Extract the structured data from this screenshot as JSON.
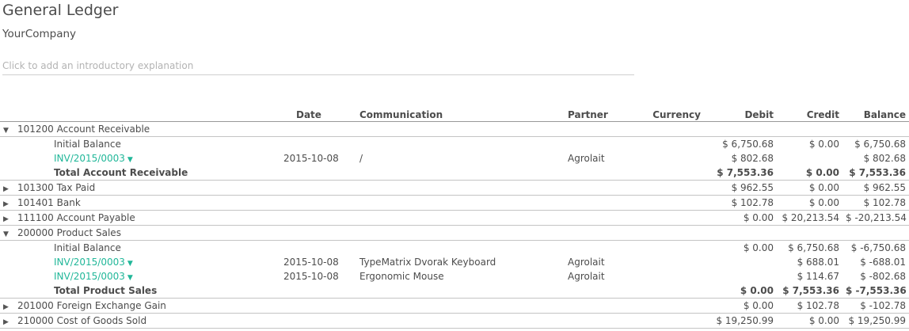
{
  "report": {
    "title": "General Ledger",
    "company": "YourCompany",
    "intro_placeholder": "Click to add an introductory explanation"
  },
  "columns": {
    "date": "Date",
    "communication": "Communication",
    "partner": "Partner",
    "currency": "Currency",
    "debit": "Debit",
    "credit": "Credit",
    "balance": "Balance"
  },
  "rows": [
    {
      "type": "account",
      "expanded": true,
      "name": "101200 Account Receivable",
      "debit": "",
      "credit": "",
      "balance": ""
    },
    {
      "type": "initial",
      "name": "Initial Balance",
      "date": "",
      "communication": "",
      "partner": "",
      "debit": "$ 6,750.68",
      "credit": "$ 0.00",
      "balance": "$ 6,750.68"
    },
    {
      "type": "move",
      "name": "INV/2015/0003",
      "date": "2015-10-08",
      "communication": "/",
      "partner": "Agrolait",
      "debit": "$ 802.68",
      "credit": "",
      "balance": "$ 802.68"
    },
    {
      "type": "total",
      "name": "Total Account Receivable",
      "debit": "$ 7,553.36",
      "credit": "$ 0.00",
      "balance": "$ 7,553.36"
    },
    {
      "type": "account",
      "expanded": false,
      "name": "101300 Tax Paid",
      "debit": "$ 962.55",
      "credit": "$ 0.00",
      "balance": "$ 962.55"
    },
    {
      "type": "account",
      "expanded": false,
      "name": "101401 Bank",
      "debit": "$ 102.78",
      "credit": "$ 0.00",
      "balance": "$ 102.78"
    },
    {
      "type": "account",
      "expanded": false,
      "name": "111100 Account Payable",
      "debit": "$ 0.00",
      "credit": "$ 20,213.54",
      "balance": "$ -20,213.54"
    },
    {
      "type": "account",
      "expanded": true,
      "name": "200000 Product Sales",
      "debit": "",
      "credit": "",
      "balance": ""
    },
    {
      "type": "initial",
      "name": "Initial Balance",
      "date": "",
      "communication": "",
      "partner": "",
      "debit": "$ 0.00",
      "credit": "$ 6,750.68",
      "balance": "$ -6,750.68"
    },
    {
      "type": "move",
      "name": "INV/2015/0003",
      "date": "2015-10-08",
      "communication": "TypeMatrix Dvorak Keyboard",
      "partner": "Agrolait",
      "debit": "",
      "credit": "$ 688.01",
      "balance": "$ -688.01"
    },
    {
      "type": "move",
      "name": "INV/2015/0003",
      "date": "2015-10-08",
      "communication": "Ergonomic Mouse",
      "partner": "Agrolait",
      "debit": "",
      "credit": "$ 114.67",
      "balance": "$ -802.68"
    },
    {
      "type": "total",
      "name": "Total Product Sales",
      "debit": "$ 0.00",
      "credit": "$ 7,553.36",
      "balance": "$ -7,553.36"
    },
    {
      "type": "account",
      "expanded": false,
      "name": "201000 Foreign Exchange Gain",
      "debit": "$ 0.00",
      "credit": "$ 102.78",
      "balance": "$ -102.78"
    },
    {
      "type": "account",
      "expanded": false,
      "name": "210000 Cost of Goods Sold",
      "debit": "$ 19,250.99",
      "credit": "$ 0.00",
      "balance": "$ 19,250.99"
    }
  ]
}
